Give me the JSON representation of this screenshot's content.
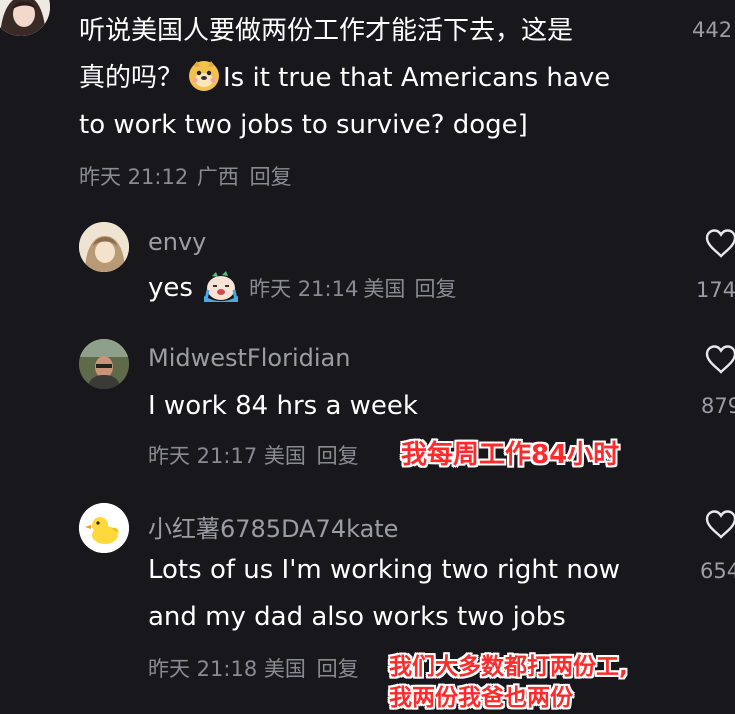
{
  "top_comment": {
    "text_line1": "听说美国人要做两份工作才能活下去，这是",
    "text_line2_prefix": "真的吗？",
    "text_line2_suffix": "Is it true that Americans have",
    "text_line3": "to work two jobs to survive? doge]",
    "emoji": "doge-emoji",
    "time": "昨天 21:12",
    "location": "广西",
    "reply_label": "回复",
    "likes": "442"
  },
  "replies": [
    {
      "username": "envy",
      "text": "yes",
      "emoji": "crying-emoji",
      "time": "昨天 21:14",
      "location": "美国",
      "reply_label": "回复",
      "likes": "174"
    },
    {
      "username": "MidwestFloridian",
      "text": "I work 84 hrs a week",
      "time": "昨天 21:17",
      "location": "美国",
      "reply_label": "回复",
      "likes": "879",
      "subtitle": "我每周工作84小时"
    },
    {
      "username": "小红薯6785DA74kate",
      "text_line1": "Lots of us I'm working two right now",
      "text_line2": "and my dad also works two jobs",
      "time": "昨天 21:18",
      "location": "美国",
      "reply_label": "回复",
      "likes": "654",
      "subtitle_line1": "我们大多数都打两份工,",
      "subtitle_line2": "我两份我爸也两份"
    }
  ],
  "colors": {
    "background": "#17171c",
    "subtitle_red": "#ff2b2b",
    "meta_gray": "#8a8a92"
  }
}
